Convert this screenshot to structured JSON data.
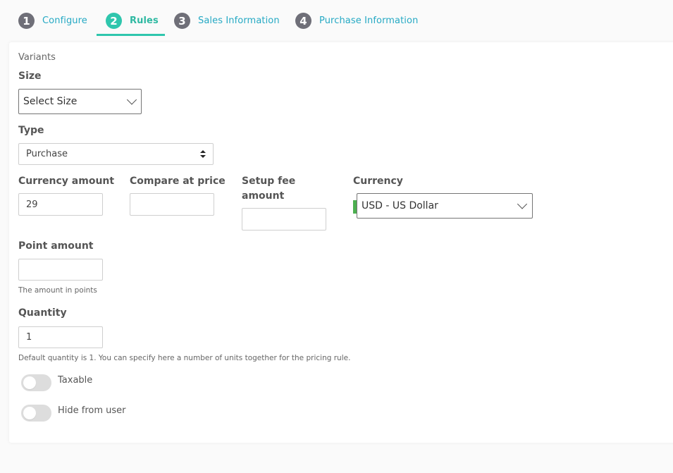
{
  "steps": [
    {
      "num": "1",
      "label": "Configure"
    },
    {
      "num": "2",
      "label": "Rules"
    },
    {
      "num": "3",
      "label": "Sales Information"
    },
    {
      "num": "4",
      "label": "Purchase Information"
    }
  ],
  "form": {
    "section_label": "Variants",
    "size": {
      "label": "Size",
      "value": "Select Size"
    },
    "type": {
      "label": "Type",
      "value": "Purchase"
    },
    "currency_amount": {
      "label": "Currency amount",
      "value": "29"
    },
    "compare_at_price": {
      "label": "Compare at price",
      "value": ""
    },
    "setup_fee": {
      "label_line1": "Setup fee",
      "label_line2": "amount",
      "value": ""
    },
    "currency": {
      "label": "Currency",
      "value": "USD - US Dollar"
    },
    "point_amount": {
      "label": "Point amount",
      "value": "",
      "help": "The amount in points"
    },
    "quantity": {
      "label": "Quantity",
      "value": "1",
      "help": "Default quantity is 1. You can specify here a number of units together for the pricing rule."
    },
    "taxable": {
      "label": "Taxable",
      "on": false
    },
    "hide_from_user": {
      "label": "Hide from user",
      "on": false
    }
  },
  "colors": {
    "active_step": "#2fc6ad",
    "inactive_step": "#6f6f78",
    "step_link": "#25a9c4",
    "currency_marker": "#4caf50"
  }
}
